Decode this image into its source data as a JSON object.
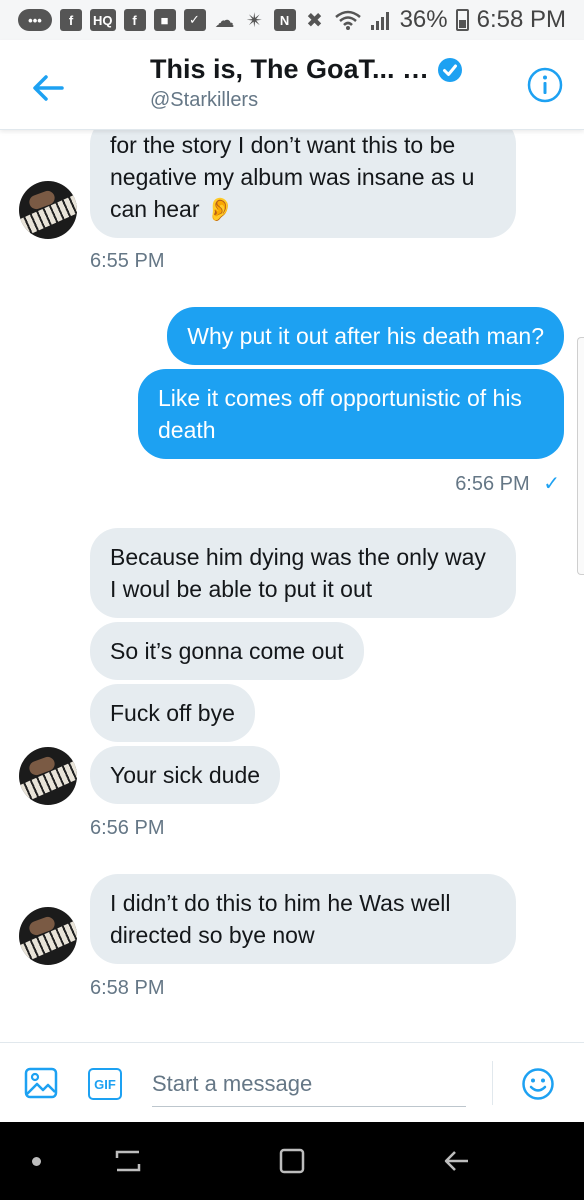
{
  "status_bar": {
    "left_icons": [
      "messages-icon",
      "facebook-icon",
      "hq-icon",
      "facebook-icon",
      "chat-icon",
      "checkbox-icon",
      "cloud-icon"
    ],
    "right_icons": [
      "bluetooth-icon",
      "nfc-icon",
      "mute-icon",
      "wifi-icon",
      "signal-icon"
    ],
    "battery": "36%",
    "time": "6:58 PM"
  },
  "header": {
    "title": "This is, The GoaT... …",
    "handle": "@Starkillers",
    "accent": "#1da1f2"
  },
  "messages": [
    {
      "id": "m1",
      "direction": "in",
      "text": "for the story I don’t want this to be negative my album was insane as u can hear 👂"
    },
    {
      "id": "m2",
      "direction": "out",
      "text": "Why put it out after his death man?"
    },
    {
      "id": "m3",
      "direction": "out",
      "text": "Like it comes off opportunistic of his death"
    },
    {
      "id": "m4",
      "direction": "in",
      "text": "Because him dying was the only way I woul be able to put it out"
    },
    {
      "id": "m5",
      "direction": "in",
      "text": "So it’s gonna come out"
    },
    {
      "id": "m6",
      "direction": "in",
      "text": "Fuck off bye"
    },
    {
      "id": "m7",
      "direction": "in",
      "text": "Your sick dude"
    },
    {
      "id": "m8",
      "direction": "in",
      "text": "I didn’t do this to him he   Was well directed so bye now"
    }
  ],
  "timestamps": {
    "t1": "6:55 PM",
    "t2": "6:56 PM",
    "t2_check": "✓",
    "t3": "6:56 PM",
    "t4": "6:58 PM"
  },
  "composer": {
    "placeholder": "Start a message",
    "gif_label": "GIF"
  },
  "colors": {
    "bubble_out": "#1da1f2",
    "bubble_in": "#e6ecf0",
    "timestamp": "#657786"
  },
  "navbar": {
    "buttons": [
      "dot-icon",
      "recents-icon",
      "home-icon",
      "back-icon"
    ]
  }
}
